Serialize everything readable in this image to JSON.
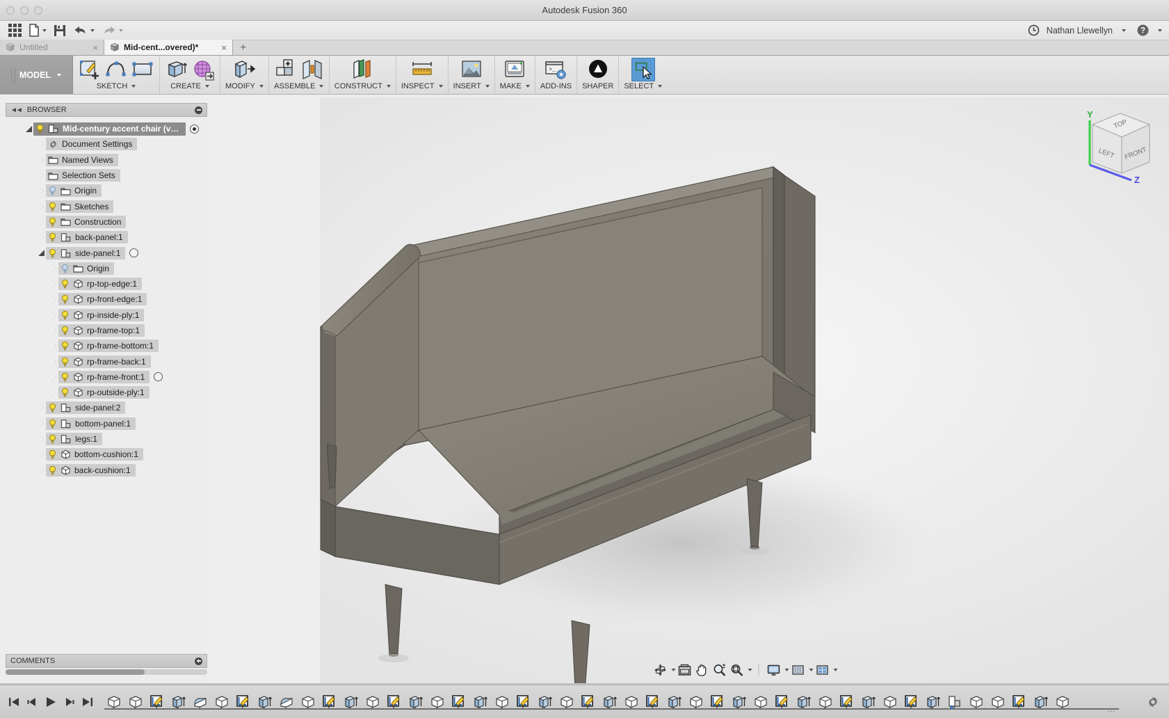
{
  "window": {
    "title": "Autodesk Fusion 360",
    "traffic_lights": [
      "close",
      "minimize",
      "zoom"
    ]
  },
  "quick_access": {
    "items": [
      {
        "name": "app-grid",
        "label": "",
        "icon": "grid-icon"
      },
      {
        "name": "new-document",
        "label": "",
        "icon": "new-file-icon",
        "has_caret": true
      },
      {
        "name": "save",
        "label": "",
        "icon": "save-icon"
      },
      {
        "name": "undo",
        "label": "",
        "icon": "undo-icon",
        "has_caret": true
      },
      {
        "name": "redo",
        "label": "",
        "icon": "redo-icon",
        "has_caret": true
      }
    ],
    "recovery_icon": "clock-icon",
    "user_name": "Nathan Llewellyn",
    "help_icon": "question-mark-icon"
  },
  "tabs": [
    {
      "label": "Untitled",
      "active": false,
      "close": "×",
      "icon": "cube-icon"
    },
    {
      "label": "Mid-cent...overed)*",
      "active": true,
      "close": "×",
      "icon": "cube-icon"
    }
  ],
  "tab_add_label": "+",
  "ribbon": {
    "workspace": "MODEL",
    "panels": [
      {
        "label": "SKETCH",
        "has_caret": true,
        "icons": [
          "create-sketch-icon",
          "spline-icon",
          "rectangle-icon"
        ]
      },
      {
        "label": "CREATE",
        "has_caret": true,
        "icons": [
          "extrude-icon",
          "form-icon"
        ]
      },
      {
        "label": "MODIFY",
        "has_caret": true,
        "icons": [
          "press-pull-icon"
        ]
      },
      {
        "label": "ASSEMBLE",
        "has_caret": true,
        "icons": [
          "new-component-icon",
          "joint-icon"
        ]
      },
      {
        "label": "CONSTRUCT",
        "has_caret": true,
        "icons": [
          "offset-plane-icon"
        ]
      },
      {
        "label": "INSPECT",
        "has_caret": true,
        "icons": [
          "measure-icon"
        ]
      },
      {
        "label": "INSERT",
        "has_caret": true,
        "icons": [
          "insert-image-icon"
        ]
      },
      {
        "label": "MAKE",
        "has_caret": true,
        "icons": [
          "3d-print-icon"
        ]
      },
      {
        "label": "ADD-INS",
        "has_caret": false,
        "icons": [
          "scripts-addins-icon"
        ]
      },
      {
        "label": "SHAPER",
        "has_caret": false,
        "icons": [
          "shaper-icon"
        ]
      },
      {
        "label": "SELECT",
        "has_caret": true,
        "icons": [
          "select-cursor-icon"
        ],
        "selected": true
      }
    ]
  },
  "browser": {
    "header": "BROWSER",
    "collapse_icon": "collapse-left-icon",
    "minimize_icon": "circle-minus-icon",
    "tree": [
      {
        "label": "Mid-century accent chair (v…",
        "depth": 0,
        "expanded": true,
        "bulb": "on",
        "icon": "component-icon",
        "selected": true,
        "marker": "filled"
      },
      {
        "label": "Document Settings",
        "depth": 1,
        "expanded": false,
        "bulb": "none",
        "icon": "gear-icon"
      },
      {
        "label": "Named Views",
        "depth": 1,
        "expanded": false,
        "bulb": "none",
        "icon": "folder-icon"
      },
      {
        "label": "Selection Sets",
        "depth": 1,
        "expanded": false,
        "bulb": "none",
        "icon": "folder-icon"
      },
      {
        "label": "Origin",
        "depth": 1,
        "expanded": false,
        "bulb": "off",
        "icon": "folder-icon"
      },
      {
        "label": "Sketches",
        "depth": 1,
        "expanded": false,
        "bulb": "on",
        "icon": "folder-icon"
      },
      {
        "label": "Construction",
        "depth": 1,
        "expanded": false,
        "bulb": "on",
        "icon": "folder-icon"
      },
      {
        "label": "back-panel:1",
        "depth": 1,
        "expanded": false,
        "bulb": "on",
        "icon": "component-icon"
      },
      {
        "label": "side-panel:1",
        "depth": 1,
        "expanded": true,
        "bulb": "on",
        "icon": "component-icon",
        "marker": "empty"
      },
      {
        "label": "Origin",
        "depth": 2,
        "expanded": false,
        "bulb": "off",
        "icon": "folder-icon"
      },
      {
        "label": "rp-top-edge:1",
        "depth": 2,
        "expanded": false,
        "bulb": "on",
        "icon": "body-icon"
      },
      {
        "label": "rp-front-edge:1",
        "depth": 2,
        "expanded": false,
        "bulb": "on",
        "icon": "body-icon"
      },
      {
        "label": "rp-inside-ply:1",
        "depth": 2,
        "expanded": false,
        "bulb": "on",
        "icon": "body-icon"
      },
      {
        "label": "rp-frame-top:1",
        "depth": 2,
        "expanded": false,
        "bulb": "on",
        "icon": "body-icon"
      },
      {
        "label": "rp-frame-bottom:1",
        "depth": 2,
        "expanded": false,
        "bulb": "on",
        "icon": "body-icon"
      },
      {
        "label": "rp-frame-back:1",
        "depth": 2,
        "expanded": false,
        "bulb": "on",
        "icon": "body-icon"
      },
      {
        "label": "rp-frame-front:1",
        "depth": 2,
        "expanded": false,
        "bulb": "on",
        "icon": "body-icon",
        "marker": "empty"
      },
      {
        "label": "rp-outside-ply:1",
        "depth": 2,
        "expanded": false,
        "bulb": "on",
        "icon": "body-icon"
      },
      {
        "label": "side-panel:2",
        "depth": 1,
        "expanded": false,
        "bulb": "on",
        "icon": "component-icon"
      },
      {
        "label": "bottom-panel:1",
        "depth": 1,
        "expanded": false,
        "bulb": "on",
        "icon": "component-icon"
      },
      {
        "label": "legs:1",
        "depth": 1,
        "expanded": false,
        "bulb": "on",
        "icon": "component-icon"
      },
      {
        "label": "bottom-cushion:1",
        "depth": 1,
        "expanded": false,
        "bulb": "on",
        "icon": "body-icon"
      },
      {
        "label": "back-cushion:1",
        "depth": 1,
        "expanded": false,
        "bulb": "on",
        "icon": "body-icon"
      }
    ]
  },
  "comments": {
    "label": "COMMENTS",
    "add_icon": "circle-plus-icon"
  },
  "viewcube": {
    "faces": [
      "TOP",
      "LEFT",
      "FRONT"
    ],
    "axes": [
      {
        "label": "Y",
        "color": "#33cc44"
      },
      {
        "label": "Z",
        "color": "#4a4adc"
      }
    ]
  },
  "navbar": {
    "items": [
      {
        "name": "orbit",
        "icon": "orbit-icon",
        "has_caret": true
      },
      {
        "name": "fit-view",
        "icon": "fit-icon",
        "has_caret": false
      },
      {
        "name": "pan",
        "icon": "pan-hand-icon",
        "has_caret": false
      },
      {
        "name": "zoom",
        "icon": "zoom-magnifier-icon",
        "has_caret": false
      },
      {
        "name": "zoom-window",
        "icon": "zoom-window-icon",
        "has_caret": true
      },
      {
        "name": "display-settings",
        "icon": "monitor-icon",
        "has_caret": true
      },
      {
        "name": "grid-snaps",
        "icon": "grid-mesh-icon",
        "has_caret": true
      },
      {
        "name": "viewports",
        "icon": "viewports-icon",
        "has_caret": true
      }
    ]
  },
  "timeline": {
    "playback": [
      {
        "name": "go-to-beginning",
        "icon": "skip-start-icon"
      },
      {
        "name": "step-back",
        "icon": "step-back-icon"
      },
      {
        "name": "play",
        "icon": "play-icon"
      },
      {
        "name": "step-forward",
        "icon": "step-forward-icon"
      },
      {
        "name": "go-to-end",
        "icon": "skip-end-icon"
      }
    ],
    "features": [
      "body-icon",
      "body-icon",
      "sketch-icon",
      "extrude-icon",
      "fillet-icon",
      "body-icon",
      "sketch-icon",
      "extrude-icon",
      "fillet-icon",
      "body-icon",
      "sketch-icon",
      "extrude-icon",
      "body-icon",
      "sketch-icon",
      "extrude-icon",
      "body-icon",
      "sketch-icon",
      "extrude-icon",
      "body-icon",
      "sketch-icon",
      "extrude-icon",
      "body-icon",
      "sketch-icon",
      "extrude-icon",
      "body-icon",
      "sketch-icon",
      "extrude-icon",
      "body-icon",
      "sketch-icon",
      "extrude-icon",
      "body-icon",
      "sketch-icon",
      "extrude-icon",
      "body-icon",
      "sketch-icon",
      "extrude-icon",
      "body-icon",
      "sketch-icon",
      "extrude-icon",
      "component-icon",
      "body-icon",
      "body-icon",
      "sketch-icon",
      "extrude-icon",
      "body-icon"
    ],
    "overflow": "…",
    "settings_icon": "gear-icon"
  },
  "colors": {
    "accent_blue": "#5b9bd5",
    "chrome_light": "#ededed",
    "chrome_mid": "#d2d2d2",
    "selection_gray": "#8c8c8c",
    "model_gray": "#6e6a63"
  }
}
